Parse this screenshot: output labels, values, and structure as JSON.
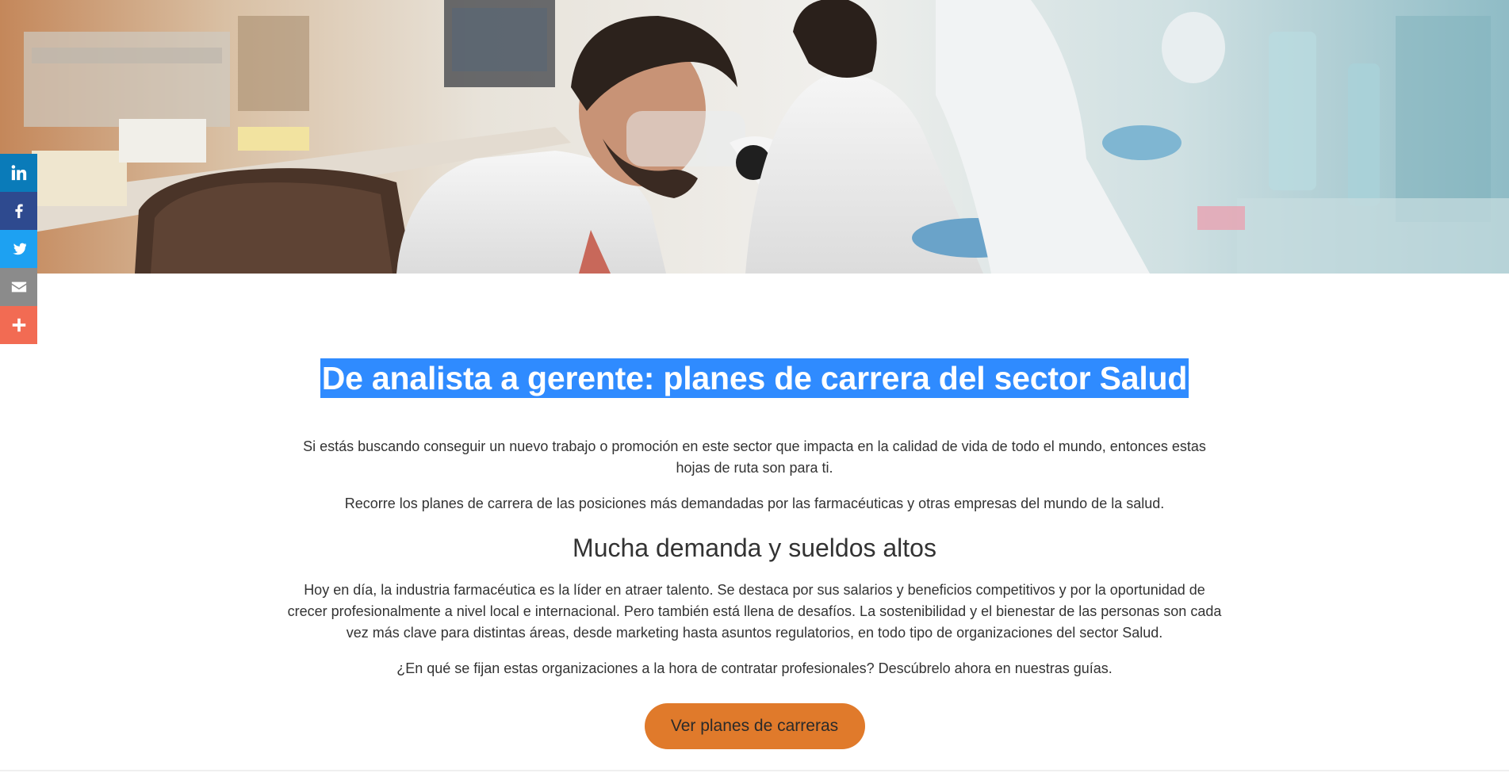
{
  "colors": {
    "accent": "#e07a2b",
    "title_highlight": "#2f8bff",
    "linkedin": "#0a7bb9",
    "facebook": "#2e4a8f",
    "twitter": "#1da1f2",
    "email": "#8b8b8b",
    "more": "#f26b53"
  },
  "hero": {
    "image": "laboratory-scientists-microscope-image"
  },
  "social": {
    "items": [
      {
        "name": "linkedin",
        "icon": "linkedin-icon"
      },
      {
        "name": "facebook",
        "icon": "facebook-icon"
      },
      {
        "name": "twitter",
        "icon": "twitter-icon"
      },
      {
        "name": "email",
        "icon": "email-icon"
      },
      {
        "name": "more",
        "icon": "plus-icon"
      }
    ]
  },
  "main": {
    "title": "De analista a gerente: planes de carrera del sector Salud",
    "intro_p1": "Si estás buscando conseguir un nuevo trabajo o promoción en este sector que impacta en la calidad de vida de todo el mundo, entonces estas hojas de ruta son para ti.",
    "intro_p2": "Recorre los planes de carrera de las posiciones más demandadas por las farmacéuticas y otras empresas del mundo de la salud.",
    "section_heading": "Mucha demanda y sueldos altos",
    "body_p1": "Hoy en día, la industria farmacéutica es la líder en atraer talento. Se destaca por sus salarios y beneficios competitivos y por la oportunidad de crecer profesionalmente a nivel local e internacional. Pero también está llena de desafíos. La sostenibilidad y el bienestar de las personas son cada vez más clave para distintas áreas, desde marketing hasta asuntos regulatorios, en todo tipo de organizaciones del sector Salud.",
    "body_p2": "¿En qué se fijan estas organizaciones a la hora de contratar profesionales? Descúbrelo ahora en nuestras guías.",
    "cta_label": "Ver planes de carreras"
  }
}
